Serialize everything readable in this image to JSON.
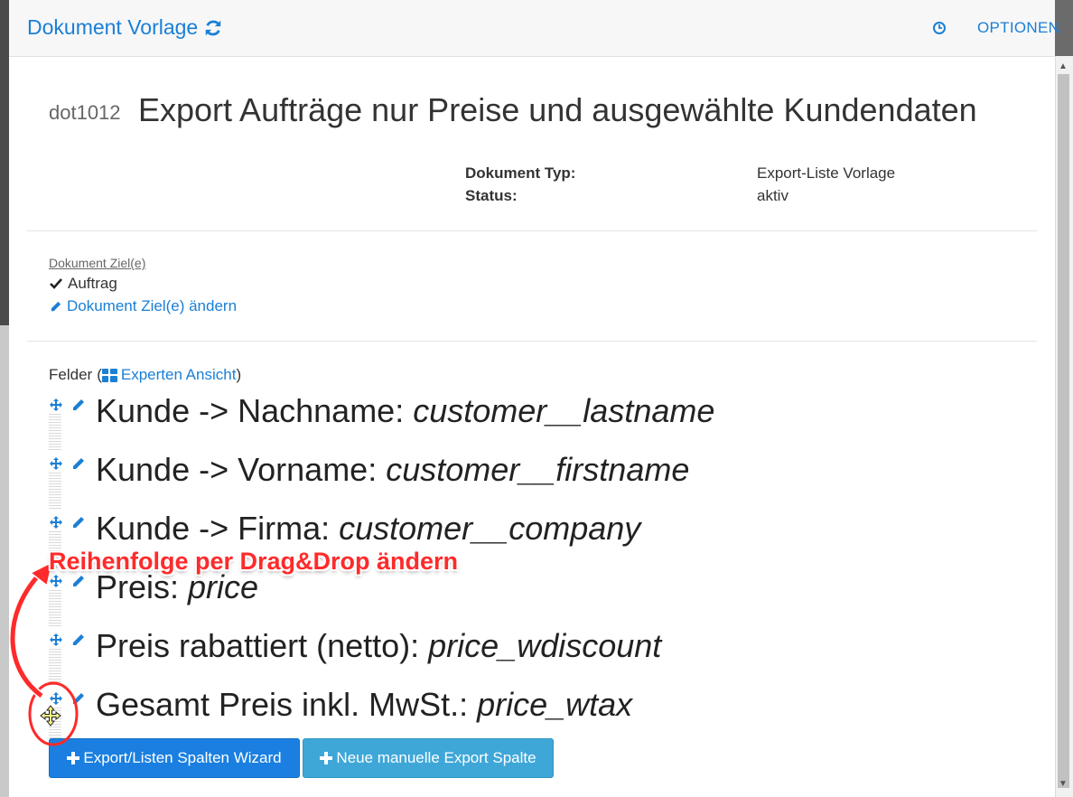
{
  "header": {
    "title": "Dokument Vorlage",
    "options_label": "OPTIONEN",
    "accent_color": "#1a7fd6"
  },
  "document": {
    "id": "dot1012",
    "title": "Export Aufträge nur Preise und ausgewählte Kundendaten",
    "meta": [
      {
        "label": "Dokument Typ:",
        "value": "Export-Liste Vorlage"
      },
      {
        "label": "Status:",
        "value": "aktiv"
      }
    ]
  },
  "targets": {
    "label": "Dokument Ziel(e)",
    "items": [
      "Auftrag"
    ],
    "change_link": "Dokument Ziel(e) ändern"
  },
  "fields": {
    "heading": "Felder",
    "open_paren": "(",
    "close_paren": ")",
    "expert_link": "Experten Ansicht",
    "items": [
      {
        "label": "Kunde -> Nachname: ",
        "key": "customer__lastname"
      },
      {
        "label": "Kunde -> Vorname: ",
        "key": "customer__firstname"
      },
      {
        "label": "Kunde -> Firma: ",
        "key": "customer__company"
      },
      {
        "label": "Preis: ",
        "key": "price"
      },
      {
        "label": "Preis rabattiert (netto): ",
        "key": "price_wdiscount"
      },
      {
        "label": "Gesamt Preis inkl. MwSt.: ",
        "key": "price_wtax"
      }
    ]
  },
  "buttons": {
    "wizard": "Export/Listen Spalten Wizard",
    "manual": "Neue manuelle Export Spalte"
  },
  "annotation": {
    "text": "Reihenfolge per Drag&Drop ändern",
    "color": "#ff2a2a"
  }
}
